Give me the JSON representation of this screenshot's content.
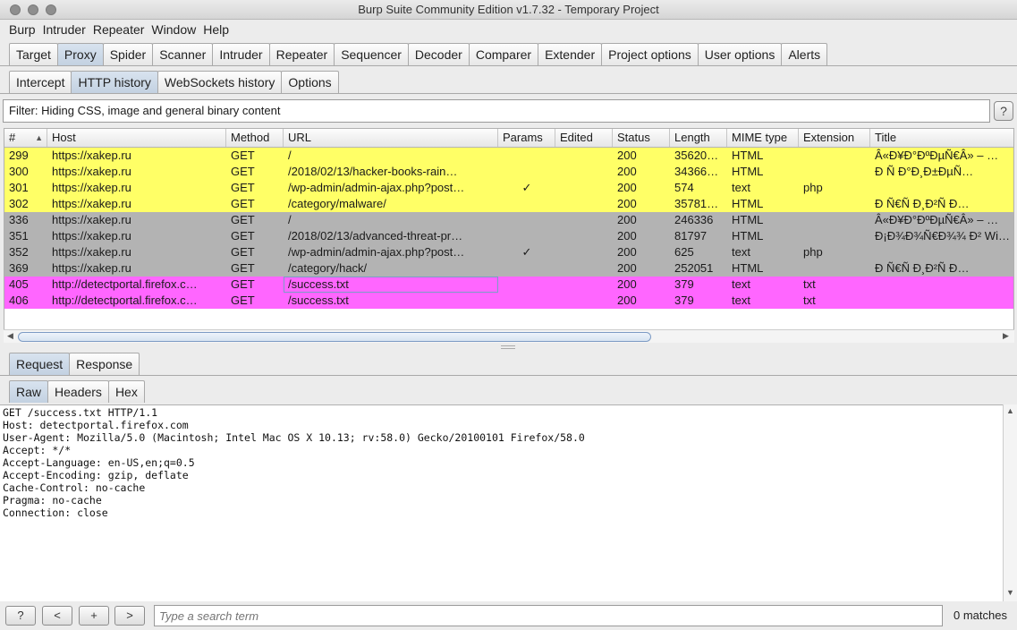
{
  "window": {
    "title": "Burp Suite Community Edition v1.7.32 - Temporary Project"
  },
  "menu": [
    "Burp",
    "Intruder",
    "Repeater",
    "Window",
    "Help"
  ],
  "main_tabs": [
    "Target",
    "Proxy",
    "Spider",
    "Scanner",
    "Intruder",
    "Repeater",
    "Sequencer",
    "Decoder",
    "Comparer",
    "Extender",
    "Project options",
    "User options",
    "Alerts"
  ],
  "main_tab_active": "Proxy",
  "proxy_tabs": [
    "Intercept",
    "HTTP history",
    "WebSockets history",
    "Options"
  ],
  "proxy_tab_active": "HTTP history",
  "filter": {
    "text": "Filter: Hiding CSS, image and general binary content",
    "help": "?"
  },
  "table": {
    "columns": [
      "#",
      "Host",
      "Method",
      "URL",
      "Params",
      "Edited",
      "Status",
      "Length",
      "MIME type",
      "Extension",
      "Title"
    ],
    "rows": [
      {
        "id": "299",
        "host": "https://xakep.ru",
        "method": "GET",
        "url": "/",
        "params": "",
        "edited": "",
        "status": "200",
        "length": "35620…",
        "mime": "HTML",
        "ext": "",
        "title": "Â«Ð¥Ð°ÐºÐµÑ€Â» – …",
        "color": "yellow"
      },
      {
        "id": "300",
        "host": "https://xakep.ru",
        "method": "GET",
        "url": "/2018/02/13/hacker-books-rain…",
        "params": "",
        "edited": "",
        "status": "200",
        "length": "34366…",
        "mime": "HTML",
        "ext": "",
        "title": "Ð   Ñ     Ð°Ð¸Ð±ÐµÑ…",
        "color": "yellow"
      },
      {
        "id": "301",
        "host": "https://xakep.ru",
        "method": "GET",
        "url": "/wp-admin/admin-ajax.php?post…",
        "params": "✓",
        "edited": "",
        "status": "200",
        "length": "574",
        "mime": "text",
        "ext": "php",
        "title": "",
        "color": "yellow"
      },
      {
        "id": "302",
        "host": "https://xakep.ru",
        "method": "GET",
        "url": "/category/malware/",
        "params": "",
        "edited": "",
        "status": "200",
        "length": "35781…",
        "mime": "HTML",
        "ext": "",
        "title": "Ð   Ñ€Ñ   Ð¸Ð²Ñ    Ð…",
        "color": "yellow"
      },
      {
        "id": "336",
        "host": "https://xakep.ru",
        "method": "GET",
        "url": "/",
        "params": "",
        "edited": "",
        "status": "200",
        "length": "246336",
        "mime": "HTML",
        "ext": "",
        "title": "Â«Ð¥Ð°ÐºÐµÑ€Â» – …",
        "color": "gray"
      },
      {
        "id": "351",
        "host": "https://xakep.ru",
        "method": "GET",
        "url": "/2018/02/13/advanced-threat-pr…",
        "params": "",
        "edited": "",
        "status": "200",
        "length": "81797",
        "mime": "HTML",
        "ext": "",
        "title": "Ð¡Ð¾Ð¾Ñ€Ð¾¾ Ð² Win…",
        "color": "gray"
      },
      {
        "id": "352",
        "host": "https://xakep.ru",
        "method": "GET",
        "url": "/wp-admin/admin-ajax.php?post…",
        "params": "✓",
        "edited": "",
        "status": "200",
        "length": "625",
        "mime": "text",
        "ext": "php",
        "title": "",
        "color": "gray"
      },
      {
        "id": "369",
        "host": "https://xakep.ru",
        "method": "GET",
        "url": "/category/hack/",
        "params": "",
        "edited": "",
        "status": "200",
        "length": "252051",
        "mime": "HTML",
        "ext": "",
        "title": "Ð   Ñ€Ñ   Ð¸Ð²Ñ    Ð…",
        "color": "gray"
      },
      {
        "id": "405",
        "host": "http://detectportal.firefox.c…",
        "method": "GET",
        "url": "/success.txt",
        "params": "",
        "edited": "",
        "status": "200",
        "length": "379",
        "mime": "text",
        "ext": "txt",
        "title": "",
        "color": "magenta"
      },
      {
        "id": "406",
        "host": "http://detectportal.firefox.c…",
        "method": "GET",
        "url": "/success.txt",
        "params": "",
        "edited": "",
        "status": "200",
        "length": "379",
        "mime": "text",
        "ext": "txt",
        "title": "",
        "color": "magenta"
      }
    ]
  },
  "message_tabs": [
    "Request",
    "Response"
  ],
  "message_tab_active": "Request",
  "view_tabs": [
    "Raw",
    "Headers",
    "Hex"
  ],
  "view_tab_active": "Raw",
  "request_lines": [
    "GET /success.txt HTTP/1.1",
    "Host: detectportal.firefox.com",
    "User-Agent: Mozilla/5.0 (Macintosh; Intel Mac OS X 10.13; rv:58.0) Gecko/20100101 Firefox/58.0",
    "Accept: */*",
    "Accept-Language: en-US,en;q=0.5",
    "Accept-Encoding: gzip, deflate",
    "Cache-Control: no-cache",
    "Pragma: no-cache",
    "Connection: close"
  ],
  "bottom": {
    "help": "?",
    "prev": "<",
    "add": "+",
    "next": ">",
    "search_placeholder": "Type a search term",
    "matches": "0 matches"
  },
  "colors": {
    "yellow": "#ffff66",
    "gray": "#b3b3b3",
    "magenta": "#ff66ff",
    "tab_active": "#c9d6e6"
  }
}
